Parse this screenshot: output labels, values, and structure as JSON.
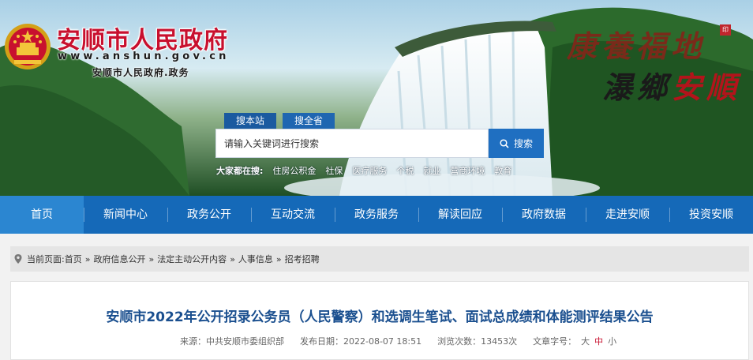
{
  "header": {
    "site_title": "安顺市人民政府",
    "site_url": "www.anshun.gov.cn",
    "site_sub": "安顺市人民政府.政务",
    "slogan_line1": "康養福地",
    "slogan_line2_a": "瀑鄉",
    "slogan_line2_b": "安順",
    "seal_text": "印"
  },
  "search": {
    "tabs": [
      "搜本站",
      "搜全省"
    ],
    "placeholder": "请输入关键词进行搜索",
    "button_label": "搜索",
    "hot_label": "大家都在搜:",
    "hot_terms": [
      "住房公积金",
      "社保",
      "医疗服务",
      "个税",
      "就业",
      "营商环境",
      "教育"
    ]
  },
  "nav": {
    "items": [
      "首页",
      "新闻中心",
      "政务公开",
      "互动交流",
      "政务服务",
      "解读回应",
      "政府数据",
      "走进安顺",
      "投资安顺"
    ],
    "active_index": 0
  },
  "breadcrumb": {
    "label": "当前页面:",
    "items": [
      "首页",
      "政府信息公开",
      "法定主动公开内容",
      "人事信息",
      "招考招聘"
    ],
    "separator": "»"
  },
  "article": {
    "title": "安顺市2022年公开招录公务员（人民警察）和选调生笔试、面试总成绩和体能测评结果公告",
    "source": "来源：中共安顺市委组织部",
    "publish_time": "发布日期：2022-08-07 18:51",
    "views": "浏览次数：13453次",
    "font_size_label": "文章字号：",
    "font_sizes": [
      "大",
      "中",
      "小"
    ]
  },
  "colors": {
    "nav_bg": "#1569b8",
    "nav_active": "#2b86d1",
    "title_red": "#c8102e",
    "article_title": "#1a4f8f"
  },
  "icons": {
    "search_button": "search-icon",
    "breadcrumb": "location-pin-icon",
    "emblem": "national-emblem-icon"
  }
}
